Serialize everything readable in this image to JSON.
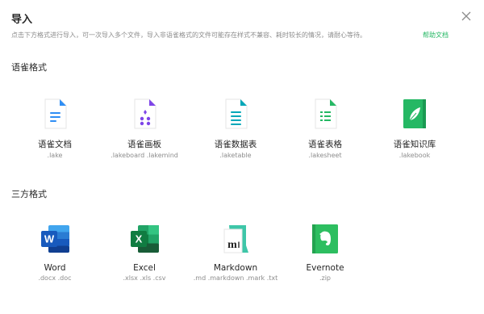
{
  "dialog": {
    "title": "导入",
    "description": "点击下方格式进行导入，可一次导入多个文件，导入非语雀格式的文件可能存在样式不兼容、耗时较长的情况，请耐心等待。",
    "help_link": "帮助文档",
    "close_icon": "close-icon"
  },
  "sections": [
    {
      "title": "语雀格式",
      "items": [
        {
          "name": "语雀文档",
          "ext": ".lake",
          "icon": "doc-icon",
          "color": "#2f8ef4"
        },
        {
          "name": "语雀画板",
          "ext": ".lakeboard .lakemind",
          "icon": "board-icon",
          "color": "#7e45e8"
        },
        {
          "name": "语雀数据表",
          "ext": ".laketable",
          "icon": "datatable-icon",
          "color": "#00a7b8"
        },
        {
          "name": "语雀表格",
          "ext": ".lakesheet",
          "icon": "sheet-icon",
          "color": "#25b864"
        },
        {
          "name": "语雀知识库",
          "ext": ".lakebook",
          "icon": "book-icon",
          "color": "#25b864"
        }
      ]
    },
    {
      "title": "三方格式",
      "items": [
        {
          "name": "Word",
          "ext": ".docx .doc",
          "icon": "word-icon",
          "color": "#2b579a"
        },
        {
          "name": "Excel",
          "ext": ".xlsx .xls .csv",
          "icon": "excel-icon",
          "color": "#217346"
        },
        {
          "name": "Markdown",
          "ext": ".md .markdown .mark .txt",
          "icon": "markdown-icon",
          "color": "#3ec6a8"
        },
        {
          "name": "Evernote",
          "ext": ".zip",
          "icon": "evernote-icon",
          "color": "#2dbe60"
        }
      ]
    }
  ]
}
